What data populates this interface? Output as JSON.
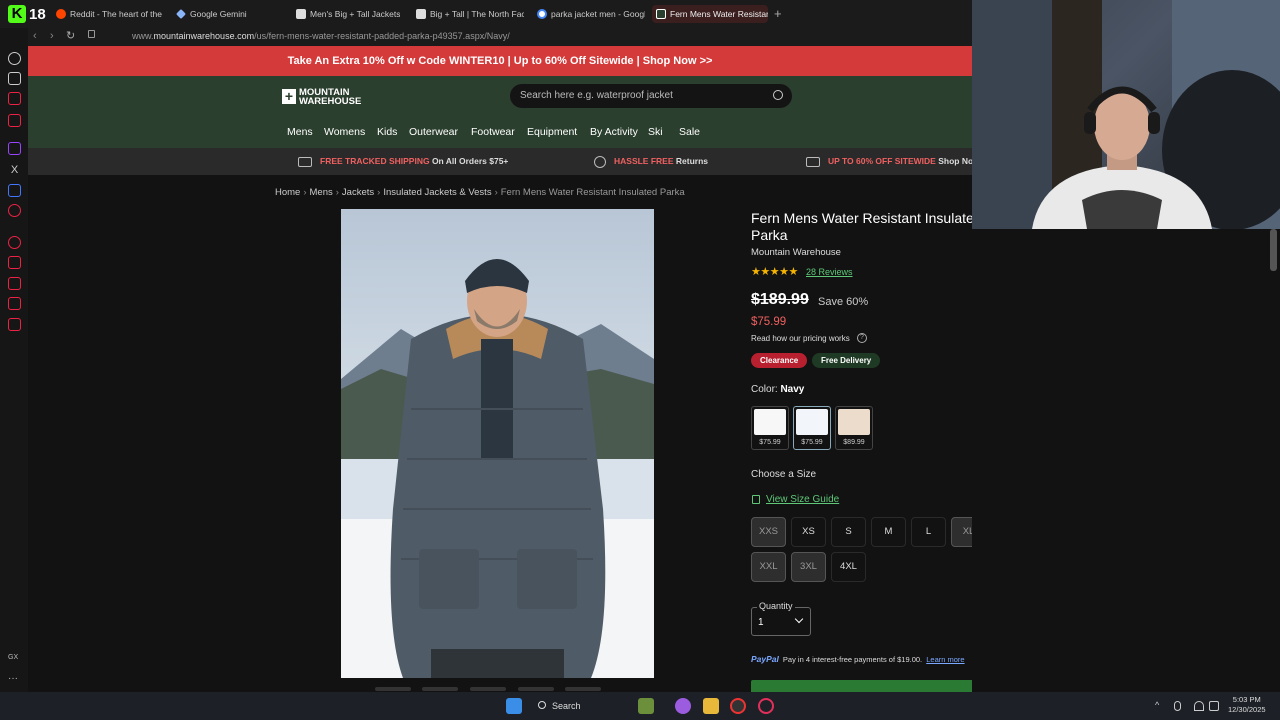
{
  "browser": {
    "brand_count": "18",
    "tabs": [
      {
        "label": "Reddit - The heart of the i",
        "color": "#ff4500"
      },
      {
        "label": "Google Gemini",
        "color": "#8ab4f8"
      },
      {
        "label": "Men's Big + Tall Jackets |",
        "color": "#cccccc"
      },
      {
        "label": "Big + Tall | The North Face",
        "color": "#cccccc"
      },
      {
        "label": "parka jacket men - Google",
        "color": "#4285f4"
      },
      {
        "label": "Fern Mens Water Resistant",
        "color": "#2b3f2e"
      }
    ],
    "url_prefix": "www.",
    "url_domain": "mountainwarehouse.com",
    "url_path": "/us/fern-mens-water-resistant-padded-parka-p49357.aspx/Navy/"
  },
  "site": {
    "promo": "Take An Extra 10% Off w Code WINTER10 | Up to 60% Off Sitewide | Shop Now >>",
    "logo_line1": "MOUNTAIN",
    "logo_line2": "WAREHOUSE",
    "search_placeholder": "Search here e.g. waterproof jacket",
    "nav": [
      "Mens",
      "Womens",
      "Kids",
      "Outerwear",
      "Footwear",
      "Equipment",
      "By Activity",
      "Ski",
      "Sale"
    ],
    "perks": [
      {
        "highlight": "FREE TRACKED SHIPPING",
        "text": " On All Orders $75+"
      },
      {
        "highlight": "HASSLE FREE",
        "text": " Returns"
      },
      {
        "highlight": "UP TO 60% OFF SITEWIDE",
        "text": " Shop No"
      }
    ],
    "breadcrumbs": [
      "Home",
      "Mens",
      "Jackets",
      "Insulated Jackets & Vests",
      "Fern Mens Water Resistant Insulated Parka"
    ]
  },
  "product": {
    "title": "Fern Mens Water Resistant Insulated Parka",
    "brand": "Mountain Warehouse",
    "stars": "★★★★★",
    "reviews": "28 Reviews",
    "was_price": "$189.99",
    "save": "Save 60%",
    "price": "$75.99",
    "pricing_link": "Read how our pricing works",
    "badges": [
      {
        "label": "Clearance",
        "color": "#b8202f"
      },
      {
        "label": "Free Delivery",
        "color": "#1f3a24"
      }
    ],
    "color_label": "Color: ",
    "color_value": "Navy",
    "swatches": [
      {
        "price": "$75.99",
        "color": "#f7f7f7"
      },
      {
        "price": "$75.99",
        "color": "#f2f5fa"
      },
      {
        "price": "$89.99",
        "color": "#ecdccc"
      }
    ],
    "size_title": "Choose a Size",
    "size_guide": "View Size Guide",
    "sizes": [
      {
        "label": "XXS",
        "available": false
      },
      {
        "label": "XS",
        "available": true
      },
      {
        "label": "S",
        "available": true
      },
      {
        "label": "M",
        "available": true
      },
      {
        "label": "L",
        "available": true
      },
      {
        "label": "XL",
        "available": false
      },
      {
        "label": "XXL",
        "available": false
      },
      {
        "label": "3XL",
        "available": false
      },
      {
        "label": "4XL",
        "available": true
      }
    ],
    "quantity_label": "Quantity",
    "quantity": "1",
    "paypal_brand": "PayPal",
    "paypal_text": "Pay in 4 interest-free payments of $19.00.",
    "paypal_link": "Learn more"
  },
  "taskbar": {
    "search": "Search",
    "time": "5:03 PM",
    "date": "12/30/2025"
  },
  "colors": {
    "promo_bg": "#d43a3a",
    "header_bg": "#2b3f2e",
    "sale_red": "#f06060",
    "link_green": "#5ec878"
  }
}
